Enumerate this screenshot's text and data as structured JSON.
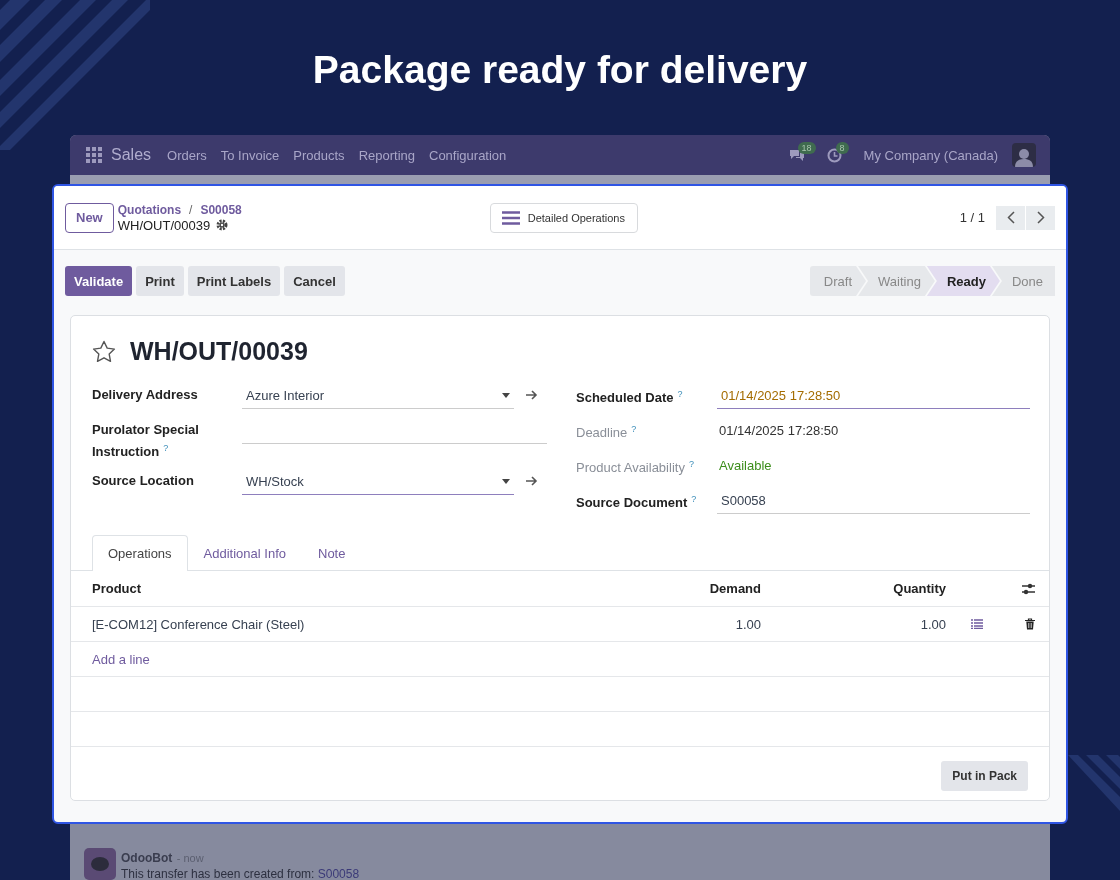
{
  "headline": "Package ready for delivery",
  "navbar": {
    "app": "Sales",
    "menu": [
      "Orders",
      "To Invoice",
      "Products",
      "Reporting",
      "Configuration"
    ],
    "badges": [
      {
        "kind": "messages",
        "count": "18"
      },
      {
        "kind": "activities",
        "count": "8"
      }
    ],
    "company": "My Company (Canada)"
  },
  "chatter": {
    "author": "OdooBot",
    "time": "- now",
    "message": "This transfer has been created from: ",
    "link": "S00058"
  },
  "control_panel": {
    "new_button": "New",
    "breadcrumb": [
      "Quotations",
      "S00058"
    ],
    "breadcrumb_separator": "/",
    "record": "WH/OUT/00039",
    "center_button": "Detailed Operations",
    "pager": "1 / 1"
  },
  "actions": [
    {
      "label": "Validate",
      "primary": true
    },
    {
      "label": "Print",
      "primary": false
    },
    {
      "label": "Print Labels",
      "primary": false
    },
    {
      "label": "Cancel",
      "primary": false
    }
  ],
  "stages": [
    {
      "label": "Draft",
      "selected": false
    },
    {
      "label": "Waiting",
      "selected": false
    },
    {
      "label": "Ready",
      "selected": true
    },
    {
      "label": "Done",
      "selected": false
    }
  ],
  "sheet": {
    "title": "WH/OUT/00039",
    "starred": false,
    "left_fields": [
      {
        "label": "Delivery Address",
        "kind": "select",
        "value": "Azure Interior"
      },
      {
        "label": "Purolator Special Instruction",
        "help": "?",
        "kind": "input"
      },
      {
        "label": "Source Location",
        "kind": "select",
        "value": "WH/Stock",
        "focused": true
      }
    ],
    "right_fields": [
      {
        "label": "Scheduled Date",
        "help": "?",
        "kind": "input",
        "value": "01/14/2025 17:28:50",
        "muted": false,
        "warning": true,
        "focused": true
      },
      {
        "label": "Deadline",
        "help": "?",
        "kind": "text",
        "value": "01/14/2025 17:28:50",
        "muted": true,
        "warning": false
      },
      {
        "label": "Product Availability",
        "help": "?",
        "kind": "status",
        "value": "Available",
        "muted": true,
        "warning": false
      },
      {
        "label": "Source Document",
        "help": "?",
        "kind": "input",
        "value": "S00058",
        "muted": false,
        "warning": false
      }
    ],
    "tabs": [
      {
        "label": "Operations",
        "selected": true
      },
      {
        "label": "Additional Info",
        "selected": false
      },
      {
        "label": "Note",
        "selected": false
      }
    ],
    "table": {
      "columns": [
        "Product",
        "Demand",
        "Quantity"
      ],
      "rows": [
        {
          "product": "[E-COM12] Conference Chair (Steel)",
          "demand": "1.00",
          "quantity": "1.00"
        }
      ],
      "add_line": "Add a line"
    },
    "pack_button": "Put in Pack"
  }
}
